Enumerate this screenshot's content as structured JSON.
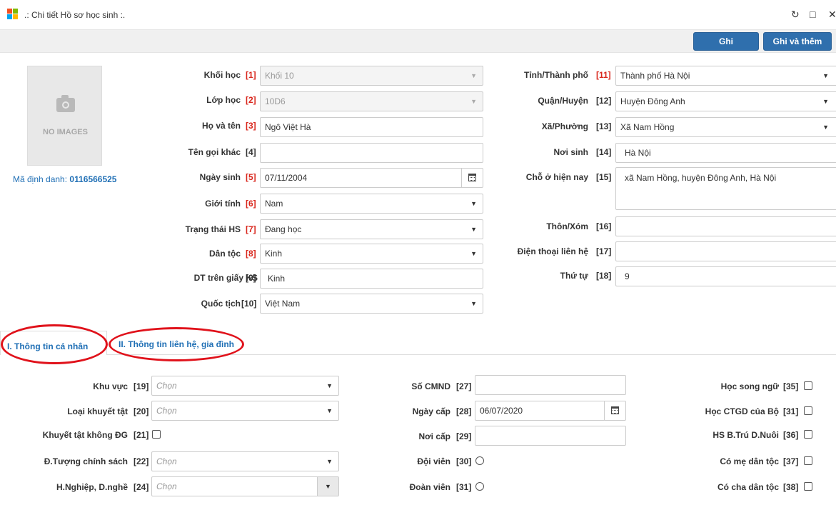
{
  "window": {
    "title": ".: Chi tiết Hồ sơ học sinh :.",
    "refresh_icon": "↻",
    "maximize_icon": "□",
    "close_icon": "✕"
  },
  "toolbar": {
    "save_label": "Ghi",
    "save_add_label": "Ghi và thêm"
  },
  "photo": {
    "placeholder": "NO IMAGES"
  },
  "student_id": {
    "label": "Mã định danh:",
    "value": "0116566525"
  },
  "left_fields": {
    "khoi_hoc": {
      "label": "Khối học",
      "num": "[1]",
      "value": "Khối 10"
    },
    "lop_hoc": {
      "label": "Lớp học",
      "num": "[2]",
      "value": "10D6"
    },
    "ho_ten": {
      "label": "Họ và tên",
      "num": "[3]",
      "value": "Ngô Việt Hà"
    },
    "ten_khac": {
      "label": "Tên gọi khác",
      "num": "[4]",
      "value": ""
    },
    "ngay_sinh": {
      "label": "Ngày sinh",
      "num": "[5]",
      "value": "07/11/2004"
    },
    "gioi_tinh": {
      "label": "Giới tính",
      "num": "[6]",
      "value": "Nam"
    },
    "trang_thai": {
      "label": "Trạng thái HS",
      "num": "[7]",
      "value": "Đang học"
    },
    "dan_toc": {
      "label": "Dân tộc",
      "num": "[8]",
      "value": "Kinh"
    },
    "dt_giay_ks": {
      "label": "DT trên giấy KS",
      "num": "[9]",
      "value": "Kinh"
    },
    "quoc_tich": {
      "label": "Quốc tịch",
      "num": "[10]",
      "value": "Việt Nam"
    }
  },
  "right_fields": {
    "tinh": {
      "label": "Tỉnh/Thành phố",
      "num": "[11]",
      "value": "Thành phố Hà Nội"
    },
    "quan": {
      "label": "Quận/Huyện",
      "num": "[12]",
      "value": "Huyện Đông Anh"
    },
    "xa": {
      "label": "Xã/Phường",
      "num": "[13]",
      "value": "Xã Nam Hồng"
    },
    "noi_sinh": {
      "label": "Nơi sinh",
      "num": "[14]",
      "value": "Hà Nội"
    },
    "cho_o": {
      "label": "Chỗ ở hiện nay",
      "num": "[15]",
      "value": "xã Nam Hồng, huyện Đông Anh, Hà Nội"
    },
    "thon_xom": {
      "label": "Thôn/Xóm",
      "num": "[16]",
      "value": ""
    },
    "dien_thoai": {
      "label": "Điện thoại liên hệ",
      "num": "[17]",
      "value": ""
    },
    "thu_tu": {
      "label": "Thứ tự",
      "num": "[18]",
      "value": "9"
    }
  },
  "tabs": {
    "personal": "I. Thông tin cá nhân",
    "contact": "II. Thông tin liên hệ, gia đình"
  },
  "tab1_col1": {
    "khu_vuc": {
      "label": "Khu vực",
      "num": "[19]",
      "value": "Chọn"
    },
    "khuyet_tat": {
      "label": "Loại khuyết tật",
      "num": "[20]",
      "value": "Chọn"
    },
    "kt_khong_dg": {
      "label": "Khuyết tật không ĐG",
      "num": "[21]",
      "checked": false
    },
    "doi_tuong": {
      "label": "Đ.Tượng chính sách",
      "num": "[22]",
      "value": "Chọn"
    },
    "nghe": {
      "label": "H.Nghiệp, D.nghề",
      "num": "[24]",
      "value": "Chọn"
    }
  },
  "tab1_col2": {
    "cmnd": {
      "label": "Số CMND",
      "num": "[27]",
      "value": ""
    },
    "ngay_cap": {
      "label": "Ngày cấp",
      "num": "[28]",
      "value": "06/07/2020"
    },
    "noi_cap": {
      "label": "Nơi cấp",
      "num": "[29]",
      "value": ""
    },
    "doi_vien": {
      "label": "Đội viên",
      "num": "[30]",
      "checked": false
    },
    "doan_vien": {
      "label": "Đoàn viên",
      "num": "[31]",
      "checked": false
    }
  },
  "tab1_col3": {
    "song_ngu": {
      "label": "Học song ngữ",
      "num": "[35]",
      "checked": false
    },
    "ctgd": {
      "label": "Học CTGD của Bộ",
      "num": "[31]",
      "checked": false
    },
    "ban_tru": {
      "label": "HS B.Trú D.Nuôi",
      "num": "[36]",
      "checked": false
    },
    "me_dan_toc": {
      "label": "Có mẹ dân tộc",
      "num": "[37]",
      "checked": false
    },
    "cha_dan_toc": {
      "label": "Có cha dân tộc",
      "num": "[38]",
      "checked": false
    }
  },
  "colors": {
    "accent": "#2f6fad",
    "required": "#d9261c",
    "link": "#1f6fb5",
    "highlight_ring": "#e0121b"
  }
}
